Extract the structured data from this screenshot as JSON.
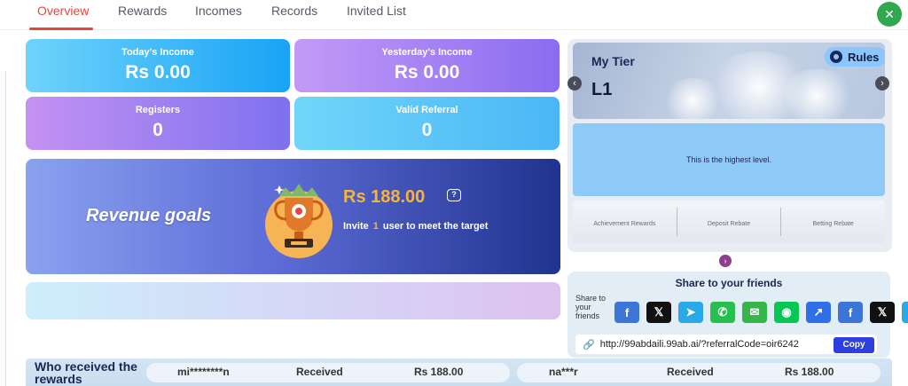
{
  "tabs": [
    "Overview",
    "Rewards",
    "Incomes",
    "Records",
    "Invited List"
  ],
  "close_label": "✕",
  "stats": {
    "todays_income": {
      "title": "Today's Income",
      "value": "Rs  0.00"
    },
    "yesterdays_income": {
      "title": "Yesterday's Income",
      "value": "Rs  0.00"
    },
    "registers": {
      "title": "Registers",
      "value": "0"
    },
    "valid_referral": {
      "title": "Valid Referral",
      "value": "0"
    }
  },
  "revenue": {
    "title": "Revenue goals",
    "amount": "Rs  188.00",
    "help_label": "?",
    "invite_prefix": "Invite",
    "invite_count": "1",
    "invite_suffix": "user to meet the target"
  },
  "tier": {
    "heading": "My Tier",
    "level": "L1",
    "rules_label": "Rules",
    "message": "This is the highest level.",
    "columns": [
      "Achievement Rewards",
      "Deposit Rebate",
      "Betting Rebate"
    ],
    "prev_arrow": "‹",
    "next_arrow": "›",
    "next_dot": "›"
  },
  "share": {
    "title": "Share to your friends",
    "label": "Share to your friends",
    "icons": [
      {
        "name": "facebook-icon",
        "glyph": "f",
        "color": "#3b76d6"
      },
      {
        "name": "x-twitter-icon",
        "glyph": "𝕏",
        "color": "#111111"
      },
      {
        "name": "telegram-icon",
        "glyph": "➤",
        "color": "#29a9e8"
      },
      {
        "name": "whatsapp-icon",
        "glyph": "✆",
        "color": "#25c04e"
      },
      {
        "name": "sms-icon",
        "glyph": "✉",
        "color": "#35b54a"
      },
      {
        "name": "line-icon",
        "glyph": "◉",
        "color": "#06c755"
      },
      {
        "name": "share-icon",
        "glyph": "↗",
        "color": "#2f6fe8"
      },
      {
        "name": "facebook-icon-2",
        "glyph": "f",
        "color": "#3b76d6"
      },
      {
        "name": "x-twitter-icon-2",
        "glyph": "𝕏",
        "color": "#111111"
      },
      {
        "name": "telegram-icon-2",
        "glyph": "➤",
        "color": "#29a9e8"
      }
    ],
    "link_icon": "🔗",
    "url": "http://99abdaili.99ab.ai/?referralCode=oir6242",
    "copy_label": "Copy"
  },
  "rewards_list": {
    "title": "Who received the rewards",
    "entries": [
      {
        "user": "mi********n",
        "status": "Received",
        "amount": "Rs  188.00"
      },
      {
        "user": "na***r",
        "status": "Received",
        "amount": "Rs  188.00"
      }
    ]
  },
  "colors": {
    "accent": "#e8443a",
    "close": "#2fa84f",
    "copy": "#2e3fe0",
    "revenue_amount": "#f5b43a"
  }
}
